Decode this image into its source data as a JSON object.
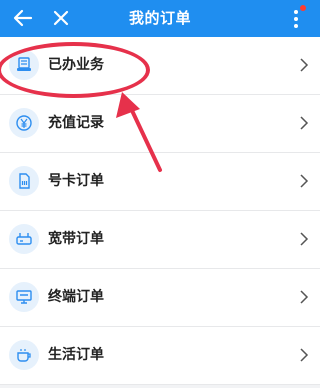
{
  "header": {
    "title": "我的订单"
  },
  "orders": [
    {
      "label": "已办业务",
      "icon": "document-icon"
    },
    {
      "label": "充值记录",
      "icon": "yuan-icon"
    },
    {
      "label": "号卡订单",
      "icon": "sim-card-icon"
    },
    {
      "label": "宽带订单",
      "icon": "router-icon"
    },
    {
      "label": "终端订单",
      "icon": "monitor-icon"
    },
    {
      "label": "生活订单",
      "icon": "cup-icon"
    }
  ],
  "colors": {
    "header": "#1f8ef0",
    "annotation": "#e6314b",
    "notification_dot": "#ff3b30"
  }
}
